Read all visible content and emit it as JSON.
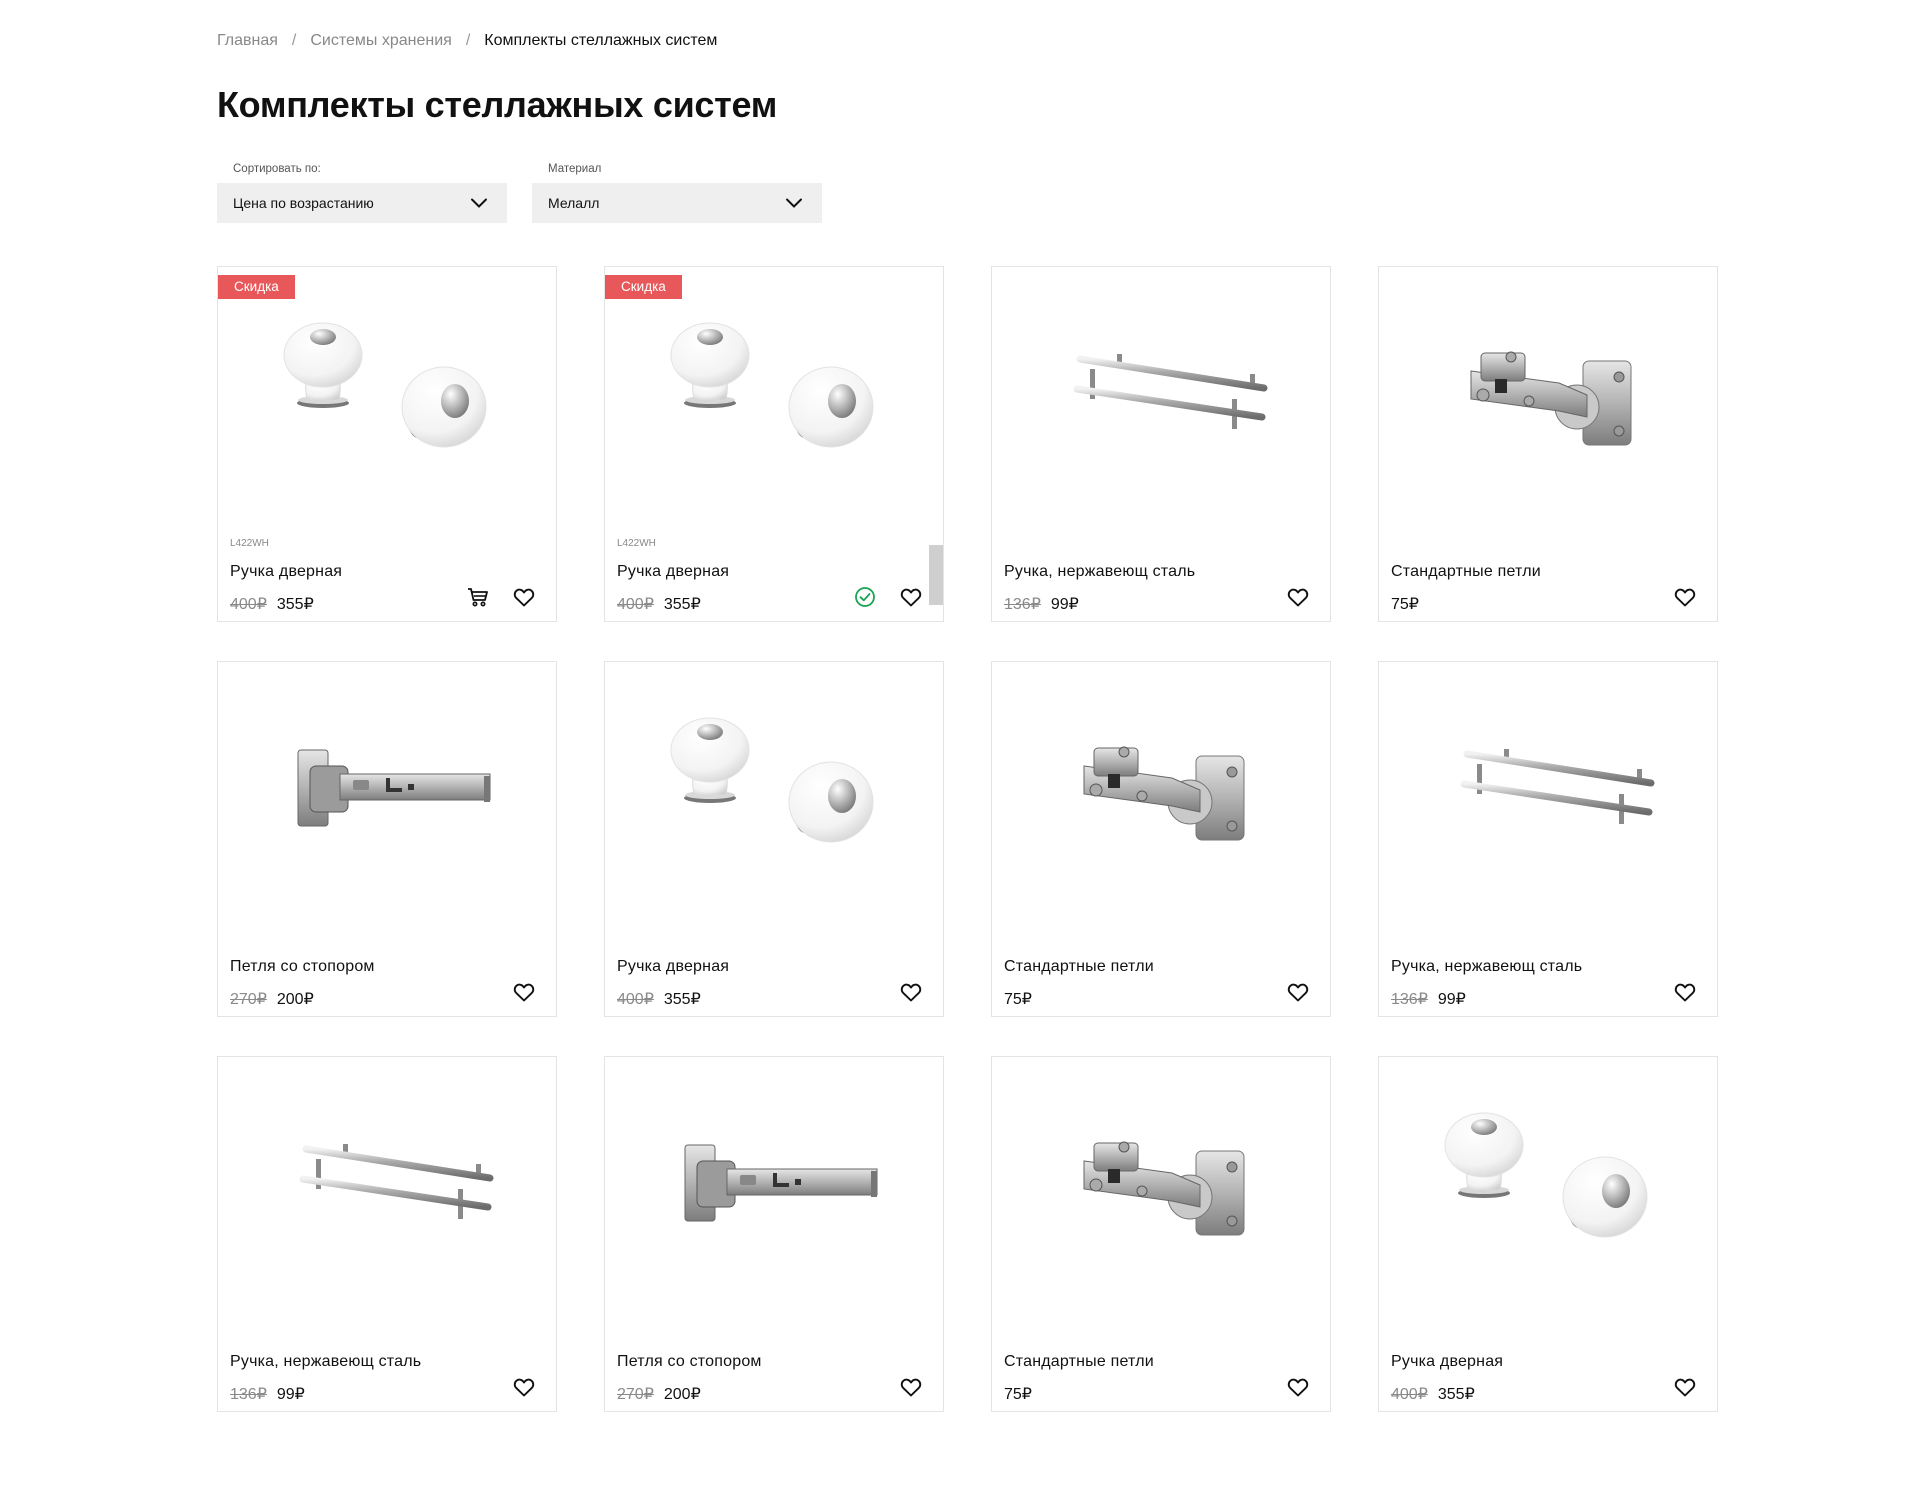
{
  "breadcrumb": {
    "items": [
      "Главная",
      "Системы хранения",
      "Комплекты стеллажных систем"
    ],
    "separator": "/"
  },
  "page": {
    "title": "Комплекты стеллажных систем"
  },
  "filters": {
    "sort": {
      "label": "Сортировать по:",
      "value": "Цена по возрастанию"
    },
    "material": {
      "label": "Материал",
      "value": "Мелалл"
    }
  },
  "colors": {
    "badge": "#e8585a",
    "success": "#1aa352",
    "border": "#e4e4e4",
    "select_bg": "#efefef"
  },
  "products": [
    {
      "badge": "Скидка",
      "sku": "L422WH",
      "name": "Ручка дверная",
      "old_price": "400₽",
      "price": "355₽",
      "image": "knob",
      "action": "cart-icon"
    },
    {
      "badge": "Скидка",
      "sku": "L422WH",
      "name": "Ручка дверная",
      "old_price": "400₽",
      "price": "355₽",
      "image": "knob",
      "action": "check-icon"
    },
    {
      "name": "Ручка, нержавеющ сталь",
      "old_price": "136₽",
      "price": "99₽",
      "image": "bar-handle"
    },
    {
      "name": "Стандартные петли",
      "price": "75₽",
      "image": "standard-hinge"
    },
    {
      "name": "Петля со стопором",
      "old_price": "270₽",
      "price": "200₽",
      "image": "stopper-hinge"
    },
    {
      "name": "Ручка дверная",
      "old_price": "400₽",
      "price": "355₽",
      "image": "knob"
    },
    {
      "name": "Стандартные петли",
      "price": "75₽",
      "image": "standard-hinge"
    },
    {
      "name": "Ручка, нержавеющ сталь",
      "old_price": "136₽",
      "price": "99₽",
      "image": "bar-handle"
    },
    {
      "name": "Ручка, нержавеющ сталь",
      "old_price": "136₽",
      "price": "99₽",
      "image": "bar-handle"
    },
    {
      "name": "Петля со стопором",
      "old_price": "270₽",
      "price": "200₽",
      "image": "stopper-hinge"
    },
    {
      "name": "Стандартные петли",
      "price": "75₽",
      "image": "standard-hinge"
    },
    {
      "name": "Ручка дверная",
      "old_price": "400₽",
      "price": "355₽",
      "image": "knob"
    }
  ]
}
